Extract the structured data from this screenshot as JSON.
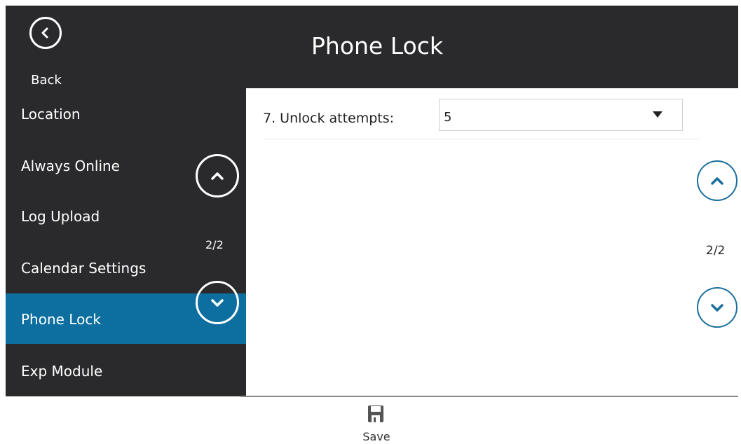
{
  "header": {
    "back_label": "Back",
    "title": "Phone Lock"
  },
  "sidebar": {
    "items": [
      {
        "label": "Location"
      },
      {
        "label": "Always Online"
      },
      {
        "label": "Log Upload"
      },
      {
        "label": "Calendar Settings"
      },
      {
        "label": "Phone Lock",
        "active": true
      },
      {
        "label": "Exp Module"
      }
    ],
    "page_indicator": "2/2"
  },
  "content": {
    "field_label": "7. Unlock attempts:",
    "field_value": "5",
    "page_indicator": "2/2"
  },
  "footer": {
    "save_label": "Save"
  },
  "colors": {
    "header_bg": "#2a2a2c",
    "active_item": "#0d6fa0",
    "nav_ring": "#1a6e9b"
  },
  "icons": [
    "chevron-left-icon",
    "chevron-up-icon",
    "chevron-down-icon",
    "caret-down-icon",
    "save-icon"
  ]
}
